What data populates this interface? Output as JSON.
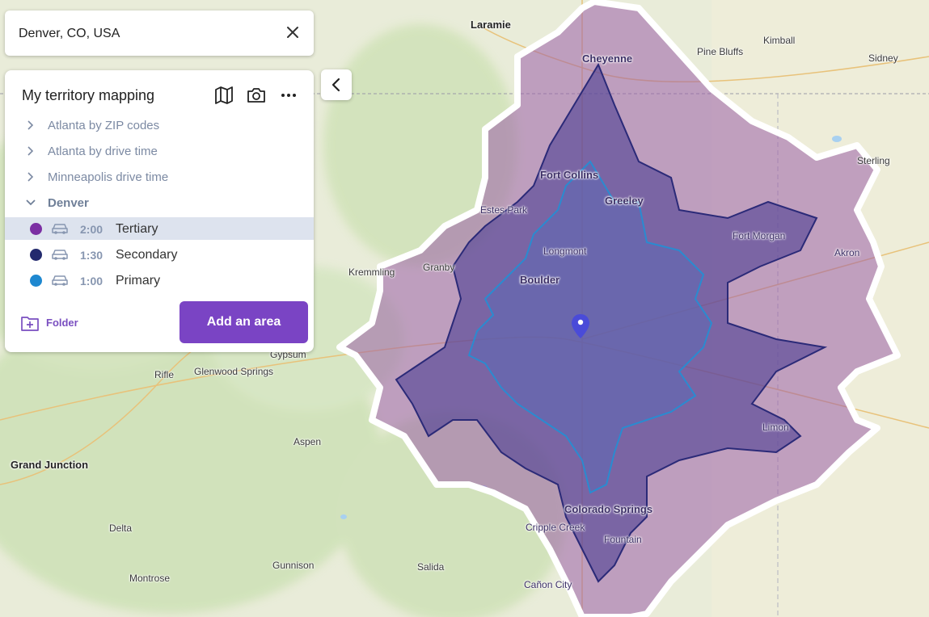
{
  "search": {
    "value": "Denver, CO, USA",
    "close_icon": "close-icon"
  },
  "panel": {
    "title": "My territory mapping",
    "tools": [
      "map-icon",
      "camera-icon",
      "more-icon"
    ],
    "collapsed_items": [
      {
        "label": "Atlanta by ZIP codes"
      },
      {
        "label": "Atlanta by drive time"
      },
      {
        "label": "Minneapolis drive time"
      }
    ],
    "open_folder": {
      "label": "Denver"
    },
    "areas": [
      {
        "time": "2:00",
        "name": "Tertiary",
        "color": "#7b2fa3",
        "selected": true
      },
      {
        "time": "1:30",
        "name": "Secondary",
        "color": "#232a6e",
        "selected": false
      },
      {
        "time": "1:00",
        "name": "Primary",
        "color": "#1e88d0",
        "selected": false
      }
    ],
    "folder_button": "Folder",
    "add_button": "Add an area"
  },
  "map": {
    "places": [
      {
        "name": "Laramie"
      },
      {
        "name": "Cheyenne"
      },
      {
        "name": "Pine Bluffs"
      },
      {
        "name": "Kimball"
      },
      {
        "name": "Sidney"
      },
      {
        "name": "Fort Collins"
      },
      {
        "name": "Greeley"
      },
      {
        "name": "Estes Park"
      },
      {
        "name": "Fort Morgan"
      },
      {
        "name": "Akron"
      },
      {
        "name": "Longmont"
      },
      {
        "name": "Kremmling"
      },
      {
        "name": "Granby"
      },
      {
        "name": "Boulder"
      },
      {
        "name": "Gypsum"
      },
      {
        "name": "Rifle"
      },
      {
        "name": "Glenwood Springs"
      },
      {
        "name": "Aspen"
      },
      {
        "name": "Grand Junction"
      },
      {
        "name": "Delta"
      },
      {
        "name": "Gunnison"
      },
      {
        "name": "Montrose"
      },
      {
        "name": "Salida"
      },
      {
        "name": "Colorado Springs"
      },
      {
        "name": "Cripple Creek"
      },
      {
        "name": "Fountain"
      },
      {
        "name": "Limon"
      },
      {
        "name": "Cañon City"
      },
      {
        "name": "Sterling"
      }
    ],
    "colors": {
      "tertiary_fill": "#9b5fa8",
      "secondary_fill": "#4d3f92",
      "primary_fill": "#5d6ab5"
    }
  }
}
